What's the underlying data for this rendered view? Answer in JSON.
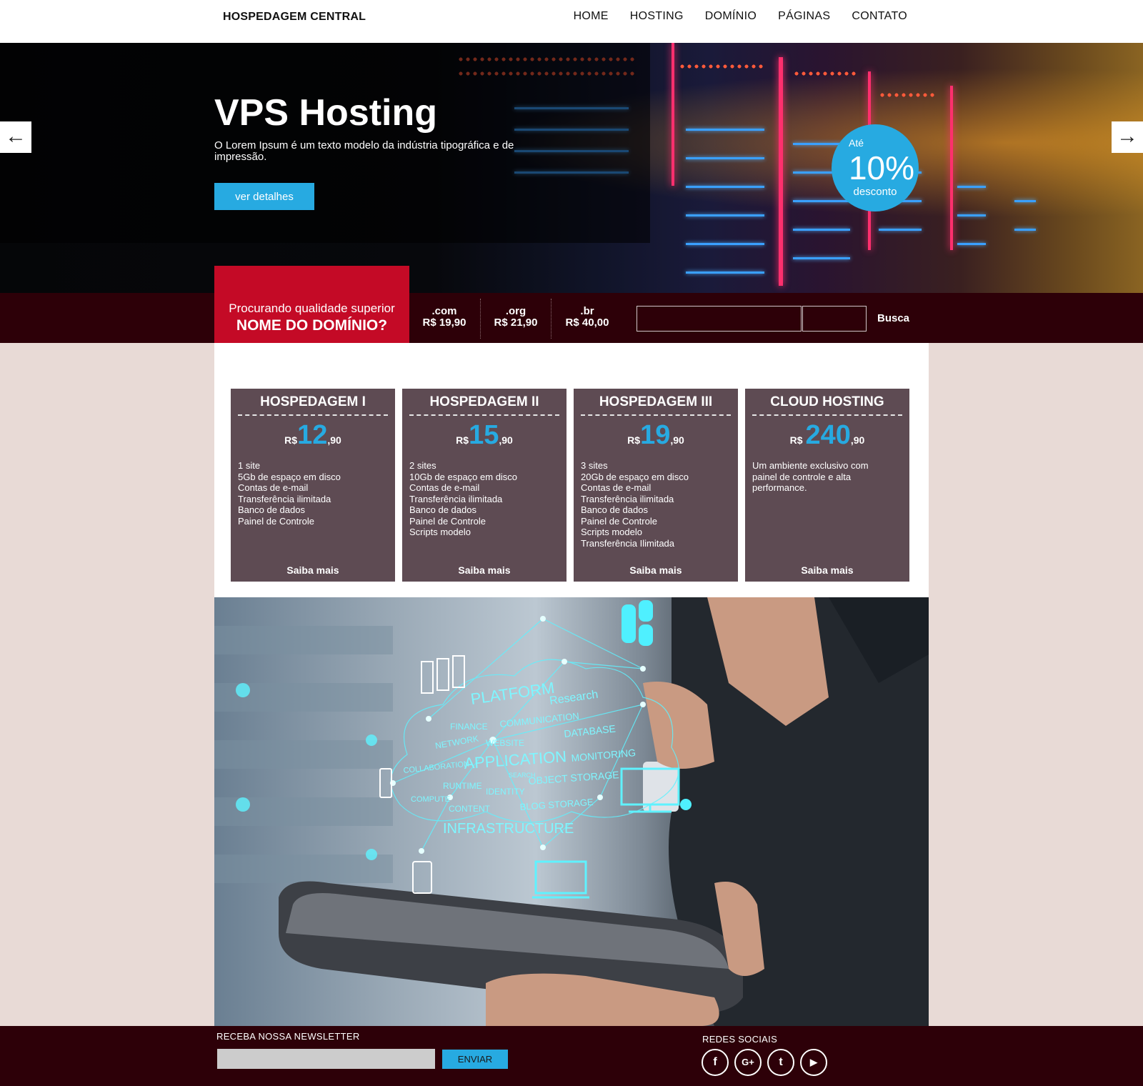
{
  "header": {
    "logo": "HOSPEDAGEM CENTRAL",
    "nav": [
      "HOME",
      "HOSTING",
      "DOMÍNIO",
      "PÁGINAS",
      "CONTATO"
    ]
  },
  "hero": {
    "title": "VPS Hosting",
    "text": "O Lorem Ipsum é um texto modelo da indústria tipográfica e de impressão.",
    "button": "ver detalhes",
    "promo": {
      "ate": "Até",
      "percent": "10%",
      "label": "desconto"
    },
    "arrow_left": "←",
    "arrow_right": "→"
  },
  "domain": {
    "question": "Procurando qualidade superior",
    "headline": "NOME DO DOMÍNIO?",
    "tlds": [
      {
        "ext": ".com",
        "price": "R$ 19,90"
      },
      {
        "ext": ".org",
        "price": "R$ 21,90"
      },
      {
        "ext": ".br",
        "price": "R$ 40,00"
      }
    ],
    "search_label": "Busca"
  },
  "plans": [
    {
      "name": "HOSPEDAGEM I",
      "currency": "R$",
      "int": "12",
      "dec": ",90",
      "features": [
        "1 site",
        "5Gb de espaço em disco",
        "Contas de e-mail",
        "Transferência ilimitada",
        "Banco de dados",
        "Painel de Controle"
      ],
      "more": "Saiba mais"
    },
    {
      "name": "HOSPEDAGEM II",
      "currency": "R$",
      "int": "15",
      "dec": ",90",
      "features": [
        "2 sites",
        "10Gb de espaço em disco",
        "Contas de e-mail",
        "Transferência ilimitada",
        "Banco de dados",
        "Painel de Controle",
        "Scripts modelo"
      ],
      "more": "Saiba mais"
    },
    {
      "name": "HOSPEDAGEM III",
      "currency": "R$",
      "int": "19",
      "dec": ",90",
      "features": [
        "3 sites",
        "20Gb de espaço em disco",
        "Contas de e-mail",
        "Transferência ilimitada",
        "Banco de dados",
        "Painel de Controle",
        "Scripts modelo",
        "Transferência Ilimitada"
      ],
      "more": "Saiba mais"
    },
    {
      "name": "CLOUD HOSTING",
      "currency": "R$ ",
      "int": "240",
      "dec": ",90",
      "features": [
        "Um ambiente exclusivo com",
        "painel de controle e alta",
        "performance."
      ],
      "more": "Saiba mais"
    }
  ],
  "cloud_words": {
    "platform": "PLATFORM",
    "research": "Research",
    "finance": "FINANCE",
    "communication": "COMMUNICATION",
    "database": "DATABASE",
    "network": "NETWORK",
    "website": "WEBSITE",
    "application": "APPLICATION",
    "monitoring": "MONITORING",
    "collaboration": "COLLABORATION",
    "search": "SEARCH",
    "runtime": "RUNTIME",
    "identity": "IDENTITY",
    "object_storage": "OBJECT STORAGE",
    "compute": "COMPUTE",
    "content": "CONTENT",
    "blog_storage": "BLOG STORAGE",
    "infrastructure": "INFRASTRUCTURE"
  },
  "footer": {
    "newsletter_label": "RECEBA NOSSA NEWSLETTER",
    "send": "ENVIAR",
    "social_label": "REDES SOCIAIS",
    "social": [
      {
        "icon": "facebook-icon",
        "glyph": "f"
      },
      {
        "icon": "google-plus-icon",
        "glyph": "G+"
      },
      {
        "icon": "twitter-icon",
        "glyph": "t"
      },
      {
        "icon": "youtube-icon",
        "glyph": "▶"
      }
    ]
  },
  "colors": {
    "accent": "#27aae1",
    "brand_red": "#c40a26",
    "dark_band": "#2d0008",
    "plan_bg": "#5e4b53",
    "page_bg": "#e8dad6"
  }
}
